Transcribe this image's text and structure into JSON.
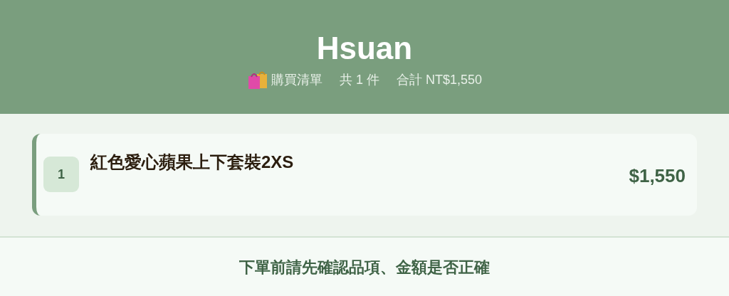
{
  "header": {
    "title": "Hsuan",
    "list_label": "購買清單",
    "count": "共 1 件",
    "total": "合計 NT$1,550"
  },
  "items": [
    {
      "index": "1",
      "name": "紅色愛心蘋果上下套裝2XS",
      "price": "$1,550"
    }
  ],
  "footer": {
    "note": "下單前請先確認品項、金額是否正確"
  }
}
